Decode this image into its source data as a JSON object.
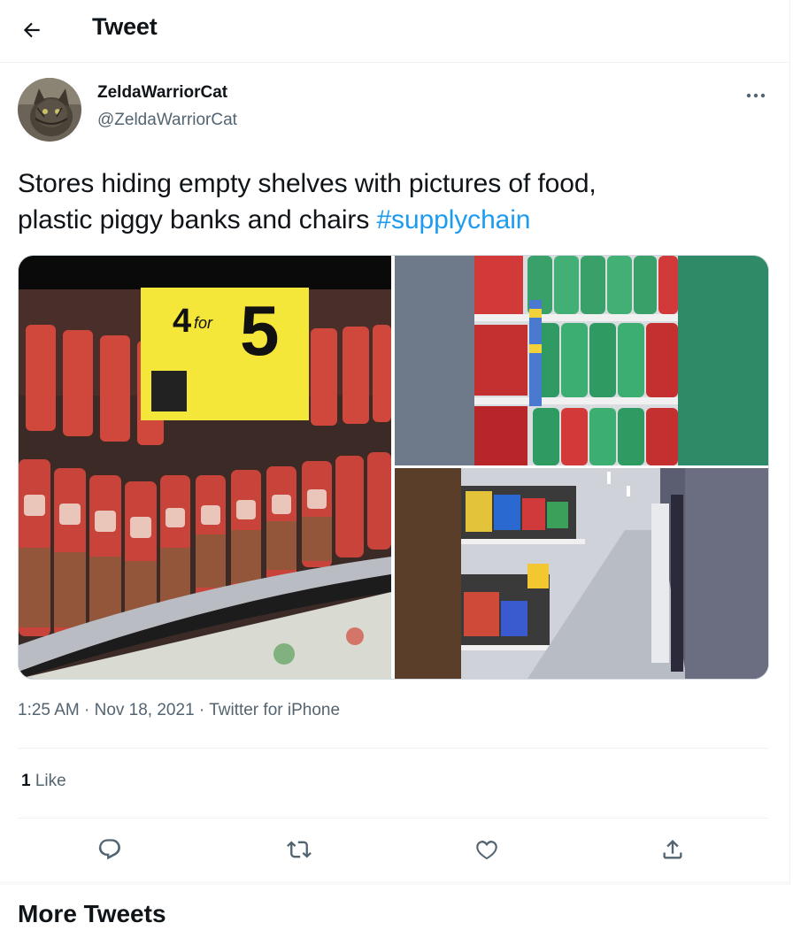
{
  "header": {
    "title": "Tweet",
    "back_icon": "back-arrow-icon"
  },
  "author": {
    "display_name": "ZeldaWarriorCat",
    "handle": "@ZeldaWarriorCat",
    "more_icon": "more-dots-icon"
  },
  "tweet": {
    "text_line1": "Stores hiding empty shelves with pictures of food,",
    "text_line2_prefix": "plastic piggy banks and chairs ",
    "hashtag": "#supplychain"
  },
  "media_price_sign": {
    "main": "4",
    "for_text": "for",
    "price": "5"
  },
  "meta": {
    "time": "1:25 AM",
    "separator1": "·",
    "date": "Nov 18, 2021",
    "separator2": "·",
    "source": "Twitter for iPhone"
  },
  "engagement": {
    "like_count": "1",
    "like_label": "Like"
  },
  "actions": {
    "reply_icon": "reply-icon",
    "retweet_icon": "retweet-icon",
    "like_icon": "heart-icon",
    "share_icon": "share-icon"
  },
  "section": {
    "more_tweets": "More Tweets"
  },
  "colors": {
    "accent": "#1d9bf0",
    "text": "#0f1419",
    "secondary": "#536471",
    "border": "#eff3f4"
  }
}
